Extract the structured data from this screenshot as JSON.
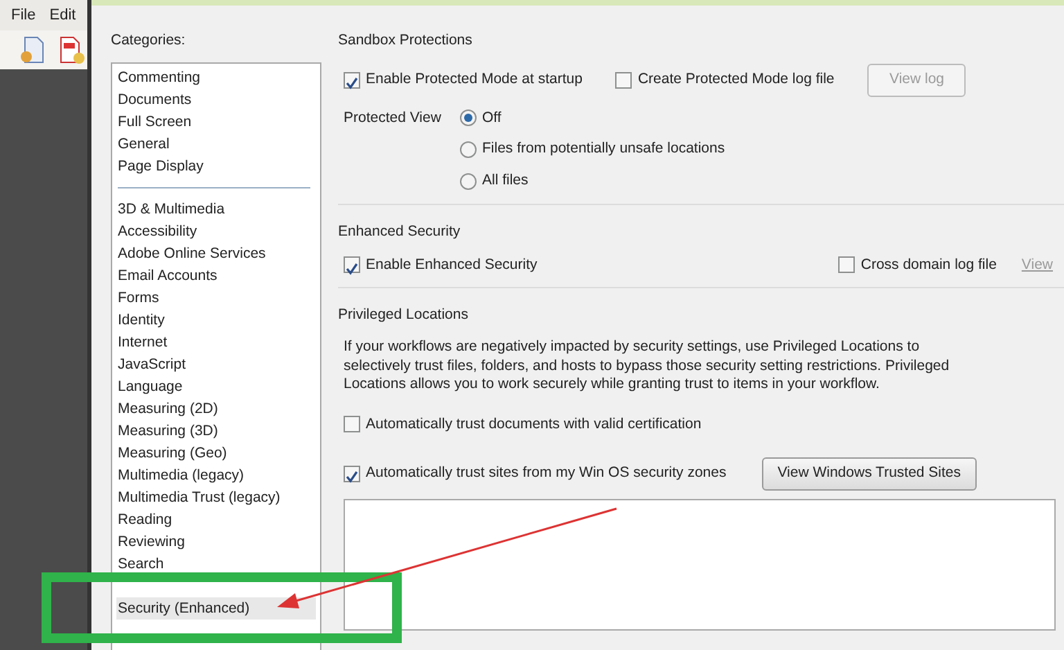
{
  "menu": [
    "File",
    "Edit"
  ],
  "categories": {
    "label": "Categories:",
    "groups": [
      [
        {
          "label": "Commenting",
          "selected": false
        },
        {
          "label": "Documents",
          "selected": false
        },
        {
          "label": "Full Screen",
          "selected": false
        },
        {
          "label": "General",
          "selected": false
        },
        {
          "label": "Page Display",
          "selected": false
        }
      ],
      [
        {
          "label": "3D & Multimedia",
          "selected": false
        },
        {
          "label": "Accessibility",
          "selected": false
        },
        {
          "label": "Adobe Online Services",
          "selected": false
        },
        {
          "label": "Email Accounts",
          "selected": false
        },
        {
          "label": "Forms",
          "selected": false
        },
        {
          "label": "Identity",
          "selected": false
        },
        {
          "label": "Internet",
          "selected": false
        },
        {
          "label": "JavaScript",
          "selected": false
        },
        {
          "label": "Language",
          "selected": false
        },
        {
          "label": "Measuring (2D)",
          "selected": false
        },
        {
          "label": "Measuring (3D)",
          "selected": false
        },
        {
          "label": "Measuring (Geo)",
          "selected": false
        },
        {
          "label": "Multimedia (legacy)",
          "selected": false
        },
        {
          "label": "Multimedia Trust (legacy)",
          "selected": false
        },
        {
          "label": "Reading",
          "selected": false
        },
        {
          "label": "Reviewing",
          "selected": false
        },
        {
          "label": "Search",
          "selected": false
        },
        {
          "label": "Security (Enhanced)",
          "selected": true
        }
      ]
    ]
  },
  "sandbox": {
    "title": "Sandbox Protections",
    "checks": [
      {
        "label": "Enable Protected Mode at startup",
        "checked": true
      },
      {
        "label": "Create Protected Mode log file",
        "checked": false
      }
    ],
    "view_log": {
      "label": "View log",
      "disabled": true
    },
    "protected_view": {
      "label": "Protected View",
      "options": [
        {
          "label": "Off",
          "selected": true
        },
        {
          "label": "Files from potentially unsafe locations",
          "selected": false
        },
        {
          "label": "All files",
          "selected": false
        }
      ]
    }
  },
  "enhanced": {
    "title": "Enhanced Security",
    "checks": [
      {
        "label": "Enable Enhanced Security",
        "checked": true
      },
      {
        "label": "Cross domain log file",
        "checked": false
      }
    ],
    "view_link": {
      "label": "View",
      "disabled": true
    }
  },
  "privileged": {
    "title": "Privileged Locations",
    "description": "If your workflows are negatively impacted by security settings, use Privileged Locations to selectively trust files, folders, and hosts to bypass those security setting restrictions. Privileged Locations allows you to work securely while granting trust to items in your workflow.",
    "checks": [
      {
        "label": "Automatically trust documents with valid certification",
        "checked": false
      },
      {
        "label": "Automatically trust sites from my Win OS security zones",
        "checked": true
      }
    ],
    "trusted_sites_button": "View Windows Trusted Sites"
  }
}
